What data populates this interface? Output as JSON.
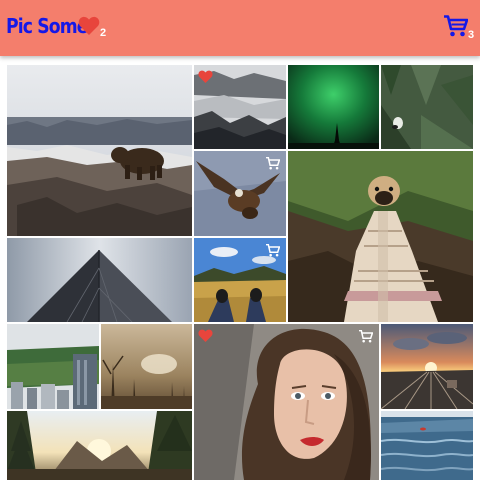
{
  "header": {
    "title": "Pic Some",
    "favorites_count": "2",
    "cart_count": "3"
  },
  "colors": {
    "header_bg": "#f47e6c",
    "title": "#1418e8",
    "heart": "#e8453c",
    "cart": "#1418e8",
    "count_text": "#ffffff",
    "cart_badge": "#ffffff",
    "heart_badge": "#e8453c"
  },
  "icons": {
    "favorites": "heart-icon",
    "cart": "cart-icon"
  },
  "photos": [
    {
      "id": "bear",
      "subject": "bear",
      "favorited": false,
      "in_cart": false
    },
    {
      "id": "misty-forest",
      "subject": "misty-forest",
      "favorited": true,
      "in_cart": false
    },
    {
      "id": "aurora",
      "subject": "aurora",
      "favorited": false,
      "in_cart": false
    },
    {
      "id": "bird-in-pines",
      "subject": "bird-in-pines",
      "favorited": false,
      "in_cart": false
    },
    {
      "id": "eagle",
      "subject": "eagle",
      "favorited": false,
      "in_cart": true
    },
    {
      "id": "pug-blanket",
      "subject": "pug-blanket",
      "favorited": false,
      "in_cart": false
    },
    {
      "id": "skyscraper",
      "subject": "skyscraper",
      "favorited": false,
      "in_cart": false
    },
    {
      "id": "feet-in-field",
      "subject": "feet-in-field",
      "favorited": false,
      "in_cart": true
    },
    {
      "id": "city-park",
      "subject": "city-park",
      "favorited": false,
      "in_cart": false
    },
    {
      "id": "dead-trees",
      "subject": "dead-trees",
      "favorited": false,
      "in_cart": false
    },
    {
      "id": "woman-portrait",
      "subject": "woman-portrait",
      "favorited": true,
      "in_cart": true
    },
    {
      "id": "rail-sunset",
      "subject": "rail-sunset",
      "favorited": false,
      "in_cart": false
    },
    {
      "id": "mountain-sunrise",
      "subject": "mountain-sunrise",
      "favorited": false,
      "in_cart": false
    },
    {
      "id": "ocean",
      "subject": "ocean",
      "favorited": false,
      "in_cart": false
    }
  ]
}
